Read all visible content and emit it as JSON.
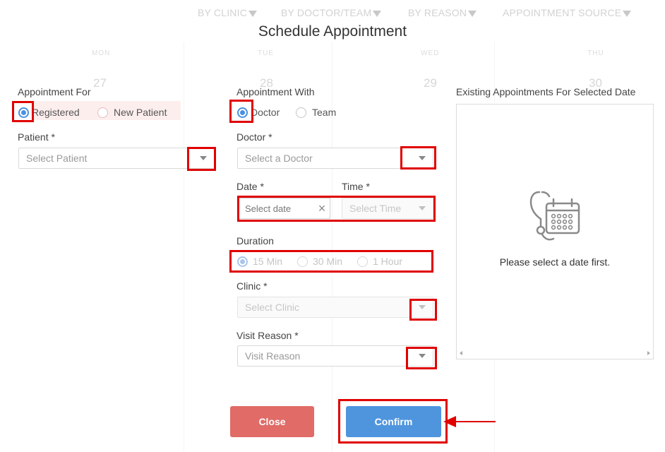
{
  "background": {
    "filters": [
      "BY CLINIC",
      "BY DOCTOR/TEAM",
      "BY REASON",
      "APPOINTMENT SOURCE"
    ],
    "days": [
      "MON",
      "TUE",
      "WED",
      "THU"
    ],
    "dates": [
      "27",
      "28",
      "29",
      "30"
    ]
  },
  "modal": {
    "title": "Schedule Appointment",
    "appointment_for": {
      "label": "Appointment For",
      "options": [
        "Registered",
        "New Patient"
      ],
      "selected": "Registered"
    },
    "patient": {
      "label": "Patient *",
      "placeholder": "Select Patient"
    },
    "appointment_with": {
      "label": "Appointment With",
      "options": [
        "Doctor",
        "Team"
      ],
      "selected": "Doctor"
    },
    "doctor": {
      "label": "Doctor *",
      "placeholder": "Select a Doctor"
    },
    "date": {
      "label": "Date *",
      "placeholder": "Select date",
      "clear_symbol": "×"
    },
    "time": {
      "label": "Time *",
      "placeholder": "Select Time"
    },
    "duration": {
      "label": "Duration",
      "options": [
        "15 Min",
        "30 Min",
        "1 Hour"
      ],
      "selected": "15 Min"
    },
    "clinic": {
      "label": "Clinic *",
      "placeholder": "Select Clinic"
    },
    "visit_reason": {
      "label": "Visit Reason *",
      "placeholder": "Visit Reason"
    },
    "existing": {
      "label": "Existing Appointments For Selected Date",
      "empty_message": "Please select a date first."
    },
    "buttons": {
      "close": "Close",
      "confirm": "Confirm"
    }
  },
  "colors": {
    "accent": "#4a90e2",
    "close_button": "#e06b67",
    "confirm_button": "#4f95de",
    "highlight": "#e00000"
  }
}
